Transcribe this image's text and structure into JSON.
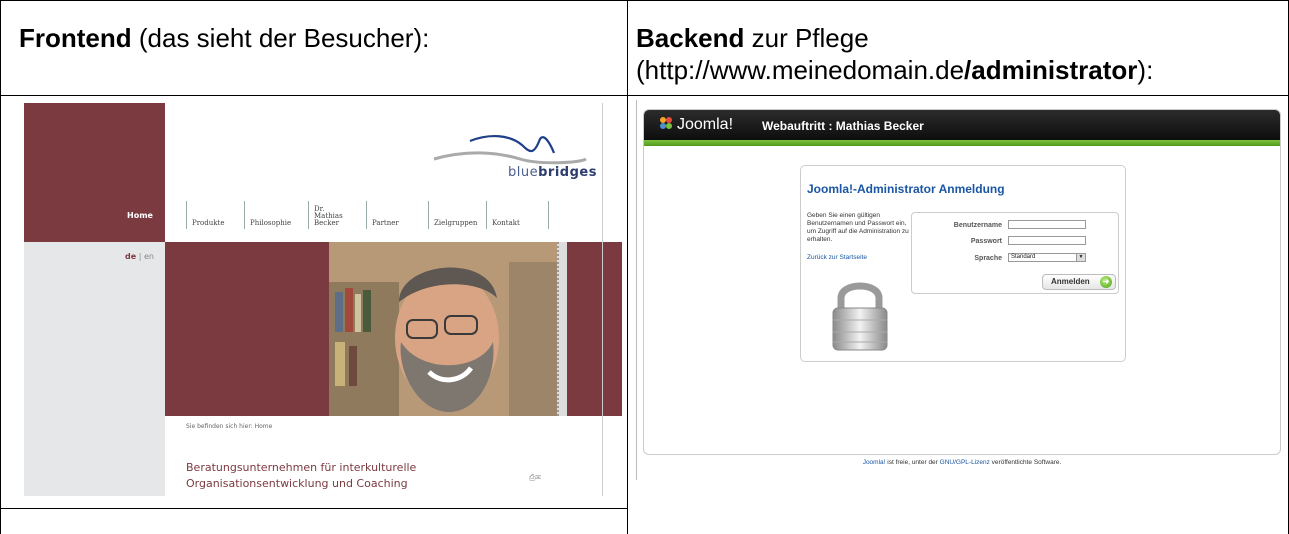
{
  "left_heading": {
    "bold": "Frontend",
    "rest": " (das sieht der Besucher):"
  },
  "right_heading": {
    "bold": "Backend",
    "rest_line1": " zur Pflege",
    "line2_plain": "(http://www.meinedomain.de",
    "line2_bold": "/administrator",
    "line2_end": "):"
  },
  "frontend": {
    "logo_text_light": "blue",
    "logo_text_bold": "bridges",
    "home_label": "Home",
    "lang_de": "de",
    "lang_sep": " | ",
    "lang_en": "en",
    "nav": [
      "Produkte",
      "Philosophie",
      "Dr. Mathias Becker",
      "Partner",
      "Zielgruppen",
      "Kontakt"
    ],
    "breadcrumb": "Sie befinden sich hier: Home",
    "title_line1": "Beratungsunternehmen für interkulturelle",
    "title_line2": "Organisationsentwicklung und Coaching",
    "colors": {
      "maroon": "#7b3a40",
      "gray": "#e6e7e9"
    }
  },
  "backend": {
    "logo": "Joomla!",
    "site_title": "Webauftritt : Mathias Becker",
    "login_title": "Joomla!-Administrator Anmeldung",
    "description": "Geben Sie einen gültigen Benutzernamen und Passwort ein, um Zugriff auf die Administration zu erhalten.",
    "back_link": "Zurück zur Startseite",
    "username_label": "Benutzername",
    "password_label": "Passwort",
    "language_label": "Sprache",
    "language_value": "Standard",
    "login_button": "Anmelden",
    "footer_link1": "Joomla!",
    "footer_text1": " ist freie, unter der ",
    "footer_link2": "GNU/GPL-Lizenz",
    "footer_text2": " veröffentlichte Software.",
    "colors": {
      "accent": "#1a56a3",
      "green": "#5ba82a",
      "header": "#111111"
    }
  }
}
